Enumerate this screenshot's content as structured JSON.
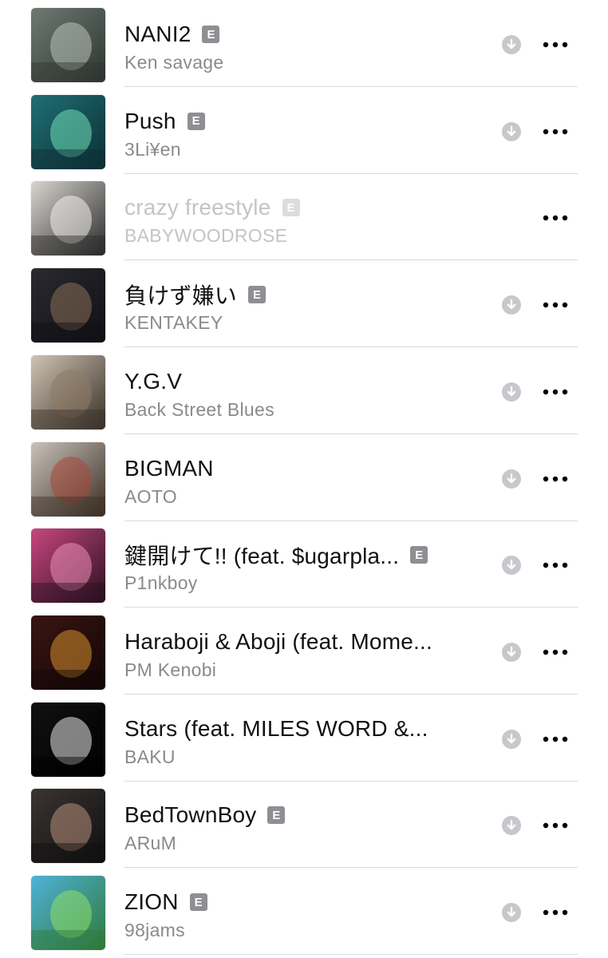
{
  "colors": {
    "title": "#111111",
    "subtitle": "#8a8a8e",
    "dimmed": "#c4c4c7",
    "badge": "#8e8e93",
    "divider": "#d9d9dc",
    "download_icon": "#c7c7cc"
  },
  "icons": {
    "download": "download-circle-icon",
    "more": "more-ellipsis-icon"
  },
  "explicit_label": "E",
  "tracks": [
    {
      "title": "NANI2",
      "artist": "Ken savage",
      "explicit": true,
      "downloadable": true,
      "dimmed": false,
      "art": [
        "#6f7a73",
        "#2e3530",
        "#b9c2bd"
      ]
    },
    {
      "title": "Push",
      "artist": "3Li¥en",
      "explicit": true,
      "downloadable": true,
      "dimmed": false,
      "art": [
        "#1f6f73",
        "#0d2f36",
        "#6fe0b8"
      ]
    },
    {
      "title": "crazy freestyle",
      "artist": "BABYWOODROSE",
      "explicit": true,
      "downloadable": false,
      "dimmed": true,
      "art": [
        "#d9d6d0",
        "#2a2a2a",
        "#f2f0ec"
      ]
    },
    {
      "title": "負けず嫌い",
      "artist": "KENTAKEY",
      "explicit": true,
      "downloadable": true,
      "dimmed": false,
      "art": [
        "#2b2a30",
        "#0f0f14",
        "#8a6f58"
      ]
    },
    {
      "title": "Y.G.V",
      "artist": "Back Street Blues",
      "explicit": false,
      "downloadable": true,
      "dimmed": false,
      "art": [
        "#cfc4b4",
        "#3a3028",
        "#8e7a66"
      ]
    },
    {
      "title": "BIGMAN",
      "artist": "AOTO",
      "explicit": false,
      "downloadable": true,
      "dimmed": false,
      "art": [
        "#c9c2b8",
        "#3b2e25",
        "#a8473a"
      ]
    },
    {
      "title": "鍵開けて!! (feat. $ugarpla...",
      "artist": "P1nkboy",
      "explicit": true,
      "downloadable": true,
      "dimmed": false,
      "art": [
        "#c8477f",
        "#2a1020",
        "#ee8fb8"
      ]
    },
    {
      "title": "Haraboji & Aboji (feat. Mome...",
      "artist": "PM Kenobi",
      "explicit": false,
      "downloadable": true,
      "dimmed": false,
      "art": [
        "#3a1512",
        "#120606",
        "#d9902f"
      ]
    },
    {
      "title": "Stars (feat. MILES WORD &...",
      "artist": "BAKU",
      "explicit": false,
      "downloadable": true,
      "dimmed": false,
      "art": [
        "#111111",
        "#000000",
        "#e8e8e8"
      ]
    },
    {
      "title": "BedTownBoy",
      "artist": "ARuM",
      "explicit": true,
      "downloadable": true,
      "dimmed": false,
      "art": [
        "#3a3432",
        "#101010",
        "#b88f7c"
      ]
    },
    {
      "title": "ZION",
      "artist": "98jams",
      "explicit": true,
      "downloadable": true,
      "dimmed": false,
      "art": [
        "#4fb2d8",
        "#2f7a3a",
        "#8fe06a"
      ]
    }
  ]
}
